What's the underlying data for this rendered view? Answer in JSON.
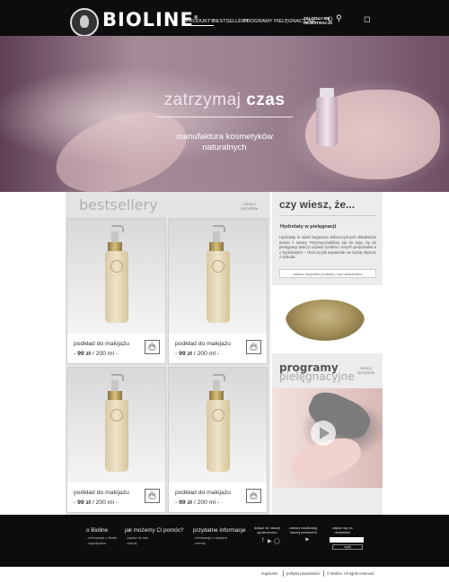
{
  "brand": {
    "name": "BIOLINE",
    "mark": "®"
  },
  "nav": {
    "items": [
      "PRODUKTY",
      "BESTSELLERY",
      "PROGRAMY PIELĘGNACYJNE"
    ],
    "login_line1": "ZALOGUJ SIĘ",
    "login_line2": "REJESTRACJA"
  },
  "icons": {
    "user": "user-icon",
    "search": "search-icon",
    "cart": "shopping-bag-icon"
  },
  "hero": {
    "title_light": "zatrzymaj",
    "title_bold": "czas",
    "subtitle_line1": "manufaktura kosmetyków",
    "subtitle_line2": "naturalnych"
  },
  "bestsellers": {
    "title": "bestsellery",
    "see_all_line1": "zobacz",
    "see_all_line2": "wszystkie",
    "products": [
      {
        "name": "podkład do makijażu",
        "price_prefix": "- ",
        "price": "99 zł",
        "volume": " / 200 ml -"
      },
      {
        "name": "podkład do makijażu",
        "price_prefix": "- ",
        "price": "99 zł",
        "volume": " / 200 ml -"
      },
      {
        "name": "podkład do makijażu",
        "price_prefix": "- ",
        "price": "99 zł",
        "volume": " / 200 ml -"
      },
      {
        "name": "podkład do makijażu",
        "price_prefix": "- ",
        "price": "99 zł",
        "volume": " / 200 ml -"
      }
    ]
  },
  "know": {
    "title": "czy wiesz, że...",
    "subtitle": "Hydrolaty w pielęgnacji",
    "body": "Hydrolaty to wiele bogactwo dobroczynnych składników prosto z natury. Przyzwyczailiśmy się do tego, by do pielęgnacji twarzy używać toników i innych preparatów a o hydrolatach – choć są tak wspaniałe nie każdy słyszał. A szkoda.",
    "button": "zobacz wszystkie produkty z tym składnikiem"
  },
  "programs": {
    "title_line1": "programy",
    "title_line2": "pielęgnacyjne",
    "see_all_line1": "zobacz",
    "see_all_line2": "wszystkie"
  },
  "footer": {
    "col1": {
      "title": "o Bioline",
      "links": [
        "- informacje o firmie",
        "- współpraca"
      ]
    },
    "col2": {
      "title": "jak możemy Ci pomóc?",
      "links": [
        "- zapisz do nas",
        "- zwroty"
      ]
    },
    "col3": {
      "title": "przydatne informacje",
      "links": [
        "- informacje o wysyłce",
        "- zwroty"
      ]
    },
    "social": {
      "line1": "dołącz do naszej",
      "line2": "społeczności"
    },
    "store": {
      "line1": "zobacz lokalizację",
      "line2": "naszej perfumerii"
    },
    "newsletter": {
      "line1": "zapisz się na",
      "line2": "newsletter",
      "button": "wyślij"
    }
  },
  "bottom": {
    "links": [
      "regulamin",
      "polityka prywatności",
      "© Bioline. All rights reserved"
    ]
  }
}
